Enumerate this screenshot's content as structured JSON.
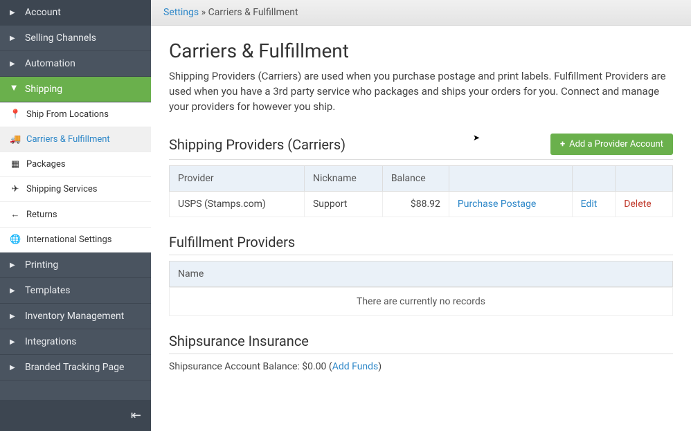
{
  "breadcrumb": {
    "root": "Settings",
    "sep": " » ",
    "current": "Carriers & Fulfillment"
  },
  "page": {
    "title": "Carriers & Fulfillment",
    "description": "Shipping Providers (Carriers) are used when you purchase postage and print labels. Fulfillment Providers are used when you have a 3rd party service who packages and ships your orders for you. Connect and manage your providers for however you ship."
  },
  "sidebar": {
    "items": [
      {
        "label": "Account"
      },
      {
        "label": "Selling Channels"
      },
      {
        "label": "Automation"
      },
      {
        "label": "Shipping",
        "active": true
      },
      {
        "label": "Printing"
      },
      {
        "label": "Templates"
      },
      {
        "label": "Inventory Management"
      },
      {
        "label": "Integrations"
      },
      {
        "label": "Branded Tracking Page"
      }
    ],
    "shipping_sub": [
      {
        "icon": "📍",
        "label": "Ship From Locations"
      },
      {
        "icon": "🚚",
        "label": "Carriers & Fulfillment",
        "selected": true
      },
      {
        "icon": "▦",
        "label": "Packages"
      },
      {
        "icon": "✈",
        "label": "Shipping Services"
      },
      {
        "icon": "←",
        "label": "Returns"
      },
      {
        "icon": "🌐",
        "label": "International Settings"
      }
    ]
  },
  "shipping_providers": {
    "heading": "Shipping Providers (Carriers)",
    "add_button": "Add a Provider Account",
    "columns": {
      "provider": "Provider",
      "nickname": "Nickname",
      "balance": "Balance"
    },
    "rows": [
      {
        "provider": "USPS (Stamps.com)",
        "nickname": "Support",
        "balance": "$88.92",
        "purchase": "Purchase Postage",
        "edit": "Edit",
        "delete": "Delete"
      }
    ]
  },
  "fulfillment": {
    "heading": "Fulfillment Providers",
    "columns": {
      "name": "Name"
    },
    "empty": "There are currently no records"
  },
  "insurance": {
    "heading": "Shipsurance Insurance",
    "balance_label": "Shipsurance Account Balance: ",
    "balance": "$0.00",
    "open": " (",
    "add_funds": "Add Funds",
    "close": ")"
  }
}
